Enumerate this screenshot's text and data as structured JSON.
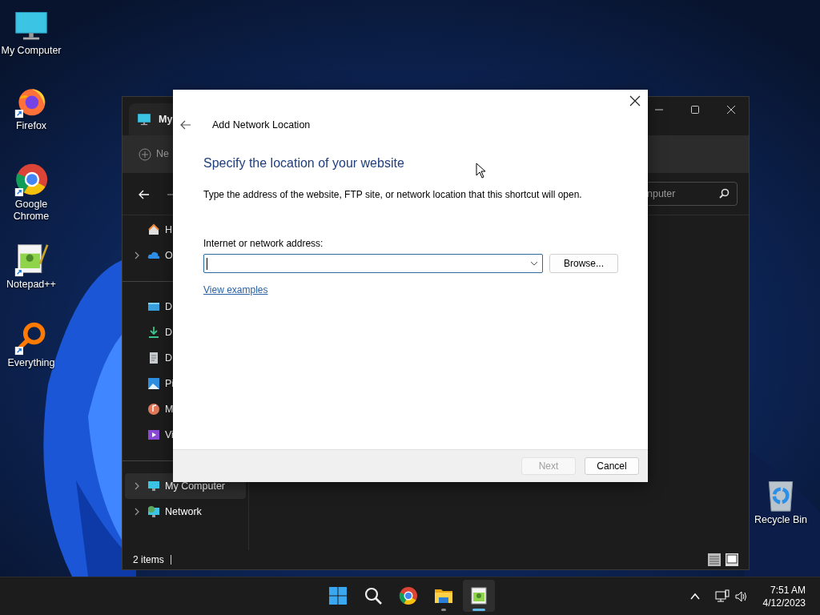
{
  "desktop_icons": [
    {
      "label": "My Computer",
      "kind": "computer",
      "shortcut": false
    },
    {
      "label": "Firefox",
      "kind": "firefox",
      "shortcut": true
    },
    {
      "label": "Google Chrome",
      "kind": "chrome",
      "shortcut": true
    },
    {
      "label": "Notepad++",
      "kind": "notepad",
      "shortcut": true
    },
    {
      "label": "Everything",
      "kind": "everything",
      "shortcut": true
    }
  ],
  "recycle_bin": {
    "label": "Recycle Bin"
  },
  "explorer": {
    "tab_title": "My",
    "new_button": "Ne",
    "search_text": "nputer",
    "sidebar": [
      {
        "label": "H",
        "kind": "home",
        "expandable": false,
        "selected": false
      },
      {
        "label": "O",
        "kind": "cloud",
        "expandable": true,
        "selected": false
      },
      {
        "kind": "separator"
      },
      {
        "label": "D",
        "kind": "desktop",
        "expandable": false,
        "selected": false
      },
      {
        "label": "D",
        "kind": "download",
        "expandable": false,
        "selected": false
      },
      {
        "label": "D",
        "kind": "document",
        "expandable": false,
        "selected": false
      },
      {
        "label": "Pi",
        "kind": "picture",
        "expandable": false,
        "selected": false
      },
      {
        "label": "M",
        "kind": "music",
        "expandable": false,
        "selected": false
      },
      {
        "label": "Vi",
        "kind": "video",
        "expandable": false,
        "selected": false
      },
      {
        "kind": "separator"
      },
      {
        "label": "My Computer",
        "kind": "computer",
        "expandable": true,
        "selected": true
      },
      {
        "label": "Network",
        "kind": "network",
        "expandable": true,
        "selected": false
      }
    ],
    "status": "2 items"
  },
  "dialog": {
    "title": "Add Network Location",
    "heading": "Specify the location of your website",
    "description": "Type the address of the website, FTP site, or network location that this shortcut will open.",
    "address_label": "Internet or network address:",
    "browse_button": "Browse...",
    "link": "View examples",
    "footer_buttons": [
      {
        "label": "Next",
        "disabled": true
      },
      {
        "label": "Cancel",
        "disabled": false
      }
    ]
  },
  "taskbar": {
    "apps": [
      {
        "kind": "start",
        "running": false,
        "active": false
      },
      {
        "kind": "search",
        "running": false,
        "active": false
      },
      {
        "kind": "chrome",
        "running": false,
        "active": false
      },
      {
        "kind": "folder",
        "running": true,
        "active": false
      },
      {
        "kind": "notepad",
        "running": true,
        "active": true
      }
    ],
    "time": "7:51 AM",
    "date": "4/12/2023"
  }
}
